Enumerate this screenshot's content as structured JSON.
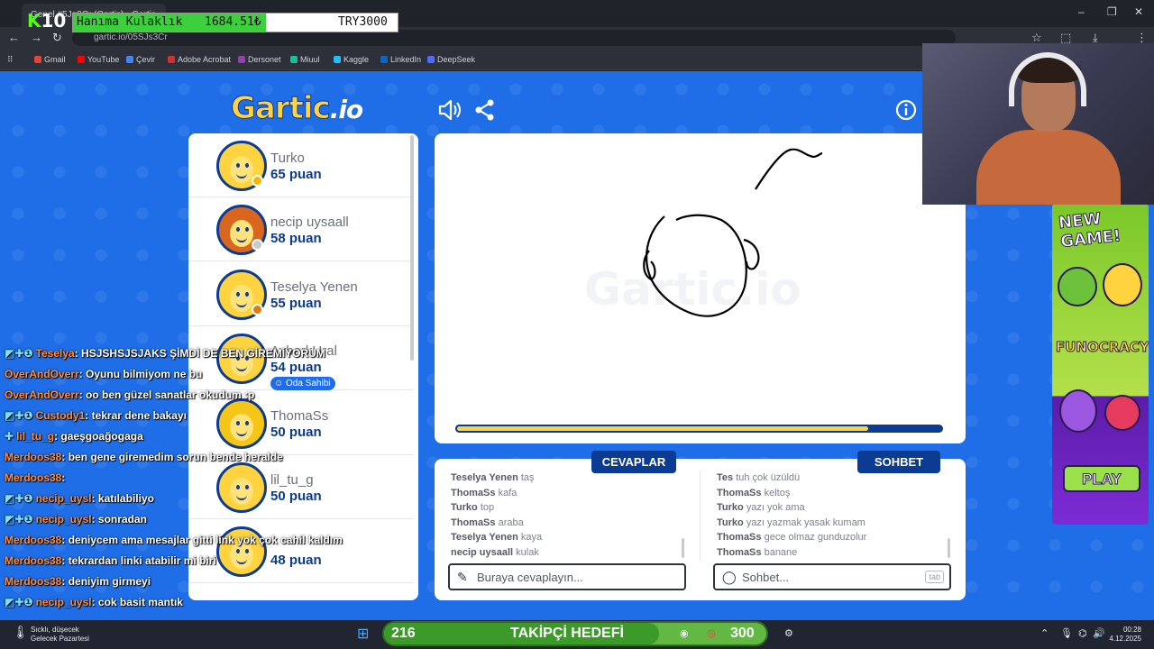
{
  "browser": {
    "tab_title": "Genel #5Jq3Cr (Gartic) - Gartic",
    "url": "gartic.io/05SJs3Cr",
    "bookmarks": [
      "Gmail",
      "YouTube",
      "Çevir",
      "Adobe Acrobat",
      "Dersonet",
      "Miuul",
      "Kaggle",
      "LinkedIn",
      "DeepSeek"
    ],
    "bookmark_colors": [
      "#ea4335",
      "#ff0000",
      "#4285f4",
      "#d32f2f",
      "#8e44ad",
      "#1abc9c",
      "#20beff",
      "#0a66c2",
      "#4d6bfe"
    ]
  },
  "donation": {
    "logo_prefix": "K",
    "logo_number": "10",
    "item": "Hanıma Kulaklık",
    "current": "1684.51₺",
    "target": "TRY3000"
  },
  "game": {
    "logo_text": "Gartic",
    "logo_suffix": ".io",
    "watermark": "Gartic.io",
    "progress": 0.85,
    "players": [
      {
        "name": "Turko",
        "score": "65 puan",
        "dot": "#f5b800",
        "hair": "#ffd23f"
      },
      {
        "name": "necip uysaall",
        "score": "58 puan",
        "dot": "#c7c9cf",
        "hair": "#d8661f"
      },
      {
        "name": "Teselya Yenen",
        "score": "55 puan",
        "dot": "#e07b14",
        "hair": "#ffd23f"
      },
      {
        "name": "AyberkUral",
        "score": "54 puan",
        "badge": "Oda Sahibi",
        "hair": "#ffd23f"
      },
      {
        "name": "ThomaSs",
        "score": "50 puan",
        "hair": "#f5c518"
      },
      {
        "name": "lil_tu_g",
        "score": "50 puan",
        "hair": "#ffd23f"
      },
      {
        "name": "",
        "score": "48 puan",
        "hair": "#ffd23f"
      }
    ],
    "answers_tab": "CEVAPLAR",
    "chat_tab": "SOHBET",
    "answers": [
      {
        "user": "Teselya Yenen",
        "text": "taş"
      },
      {
        "user": "ThomaSs",
        "text": "kafa"
      },
      {
        "user": "Turko",
        "text": "top"
      },
      {
        "user": "ThomaSs",
        "text": "araba"
      },
      {
        "user": "Teselya Yenen",
        "text": "kaya"
      },
      {
        "user": "necip uysaall",
        "text": "kulak"
      }
    ],
    "chat": [
      {
        "user": "Tes",
        "text": "tuh çok üzüldü"
      },
      {
        "user": "ThomaSs",
        "text": "keltoş"
      },
      {
        "user": "Turko",
        "text": "yazı yok ama"
      },
      {
        "user": "Turko",
        "text": "yazı yazmak yasak kumam"
      },
      {
        "user": "ThomaSs",
        "text": "gece olmaz gunduzolur"
      },
      {
        "user": "ThomaSs",
        "text": "banane"
      }
    ],
    "answer_placeholder": "Buraya cevaplayın...",
    "chat_placeholder": "Sohbet...",
    "tab_key": "tab"
  },
  "ad": {
    "title": "NEW GAME!",
    "brand": "FUNOCRACY",
    "play": "PLAY"
  },
  "stream_chat": [
    {
      "user": "Teselya",
      "msg": ": HSJSHSJSJAKS ŞİMDİ DE BEN GİREMİYORUM",
      "badges": "◩✚❶"
    },
    {
      "user": "OverAndOverr",
      "msg": ": Oyunu bilmiyom ne bu",
      "badges": ""
    },
    {
      "user": "OverAndOverr",
      "msg": ": oo ben güzel sanatlar okudum :p",
      "badges": ""
    },
    {
      "user": "Custody1",
      "msg": ": tekrar dene bakayı",
      "badges": "◩✚❶"
    },
    {
      "user": "lil_tu_g",
      "msg": ": gaeşgoağogaga",
      "badges": "✚"
    },
    {
      "user": "Merdoos38",
      "msg": ": ben gene giremedim sorun bende heralde",
      "badges": ""
    },
    {
      "user": "Merdoos38",
      "msg": ":",
      "badges": ""
    },
    {
      "user": "necip_uysl",
      "msg": ": katılabiliyo",
      "badges": "◩✚❶"
    },
    {
      "user": "necip_uysl",
      "msg": ": sonradan",
      "badges": "◩✚❶"
    },
    {
      "user": "Merdoos38",
      "msg": ": deniycem ama mesajlar gitti link yok çok cahil kaldım",
      "badges": ""
    },
    {
      "user": "Merdoos38",
      "msg": ": tekrardan linki atabilir mi biri",
      "badges": ""
    },
    {
      "user": "Merdoos38",
      "msg": ": deniyim girmeyi",
      "badges": ""
    },
    {
      "user": "necip_uysl",
      "msg": ": cok basit mantık",
      "badges": "◩✚❶"
    }
  ],
  "taskbar": {
    "weather_line1": "Sıcklı, düşecek",
    "weather_line2": "Gelecek Pazartesi",
    "goal_current": "216",
    "goal_label": "TAKİPÇİ HEDEFİ",
    "goal_target": "300",
    "goal_progress": 0.72,
    "time": "00:28",
    "date": "4.12.2025"
  }
}
